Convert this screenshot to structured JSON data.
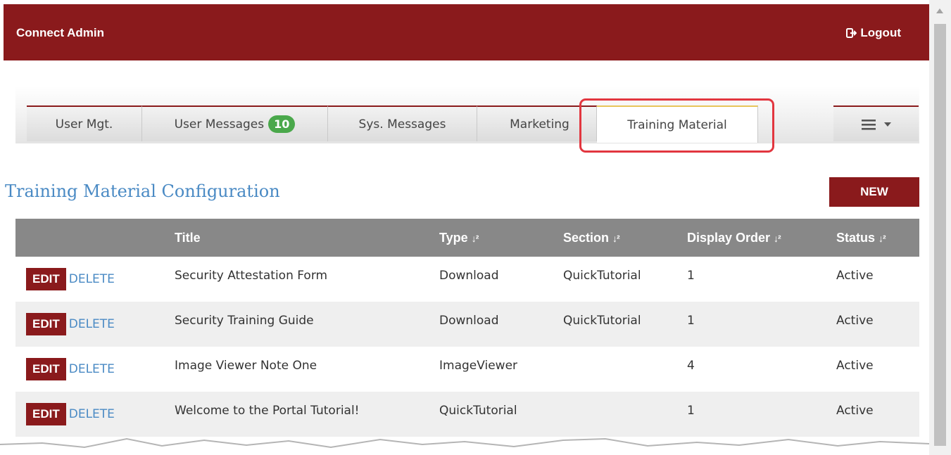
{
  "header": {
    "brand": "Connect Admin",
    "logout_label": "Logout"
  },
  "tabs": [
    {
      "label": "User Mgt."
    },
    {
      "label": "User Messages",
      "badge": "10"
    },
    {
      "label": "Sys. Messages"
    },
    {
      "label": "Marketing"
    },
    {
      "label": "Training Material",
      "active": true
    }
  ],
  "menu_icon": "hamburger-icon",
  "page": {
    "title": "Training Material Configuration",
    "new_label": "NEW"
  },
  "table": {
    "columns": [
      "",
      "Title",
      "Type",
      "Section",
      "Display Order",
      "Status"
    ],
    "sortable": [
      false,
      false,
      true,
      true,
      true,
      true
    ],
    "rows": [
      {
        "edit": "EDIT",
        "delete": "DELETE",
        "title": "Security Attestation Form",
        "type": "Download",
        "section": "QuickTutorial",
        "order": "1",
        "status": "Active"
      },
      {
        "edit": "EDIT",
        "delete": "DELETE",
        "title": "Security Training Guide",
        "type": "Download",
        "section": "QuickTutorial",
        "order": "1",
        "status": "Active"
      },
      {
        "edit": "EDIT",
        "delete": "DELETE",
        "title": "Image Viewer Note One",
        "type": "ImageViewer",
        "section": "",
        "order": "4",
        "status": "Active"
      },
      {
        "edit": "EDIT",
        "delete": "DELETE",
        "title": "Welcome to the Portal Tutorial!",
        "type": "QuickTutorial",
        "section": "",
        "order": "1",
        "status": "Active"
      }
    ]
  },
  "colors": {
    "brand": "#8a1a1c",
    "link": "#4a8ac4",
    "badge": "#4aa84b",
    "highlight": "#e2363f",
    "active_tab_accent": "#e8c55a",
    "table_header": "#888888"
  }
}
